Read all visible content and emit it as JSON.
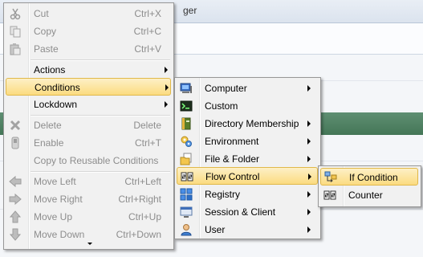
{
  "window": {
    "title_fragment": "ger"
  },
  "context_menu": {
    "items": [
      {
        "label": "Cut",
        "shortcut": "Ctrl+X",
        "icon": "cut-icon",
        "enabled": false
      },
      {
        "label": "Copy",
        "shortcut": "Ctrl+C",
        "icon": "copy-icon",
        "enabled": false
      },
      {
        "label": "Paste",
        "shortcut": "Ctrl+V",
        "icon": "paste-icon",
        "enabled": false
      },
      {
        "label": "Actions",
        "submenu": true,
        "enabled": true
      },
      {
        "label": "Conditions",
        "submenu": true,
        "enabled": true,
        "highlighted": true
      },
      {
        "label": "Lockdown",
        "submenu": true,
        "enabled": true
      },
      {
        "label": "Delete",
        "shortcut": "Delete",
        "icon": "delete-icon",
        "enabled": false
      },
      {
        "label": "Enable",
        "shortcut": "Ctrl+T",
        "icon": "enable-icon",
        "enabled": false
      },
      {
        "label": "Copy to Reusable Conditions",
        "enabled": false
      },
      {
        "label": "Move Left",
        "shortcut": "Ctrl+Left",
        "icon": "arrow-left-icon",
        "enabled": false
      },
      {
        "label": "Move Right",
        "shortcut": "Ctrl+Right",
        "icon": "arrow-right-icon",
        "enabled": false
      },
      {
        "label": "Move Up",
        "shortcut": "Ctrl+Up",
        "icon": "arrow-up-icon",
        "enabled": false
      },
      {
        "label": "Move Down",
        "shortcut": "Ctrl+Down",
        "icon": "arrow-down-icon",
        "enabled": false
      }
    ]
  },
  "conditions_menu": {
    "items": [
      {
        "label": "Computer",
        "submenu": true,
        "icon": "computer-icon"
      },
      {
        "label": "Custom",
        "submenu": false,
        "icon": "custom-script-icon"
      },
      {
        "label": "Directory Membership",
        "submenu": true,
        "icon": "directory-book-icon"
      },
      {
        "label": "Environment",
        "submenu": true,
        "icon": "environment-gear-icon"
      },
      {
        "label": "File & Folder",
        "submenu": true,
        "icon": "file-folder-icon"
      },
      {
        "label": "Flow Control",
        "submenu": true,
        "icon": "flow-control-icon",
        "highlighted": true
      },
      {
        "label": "Registry",
        "submenu": true,
        "icon": "registry-cubes-icon"
      },
      {
        "label": "Session & Client",
        "submenu": true,
        "icon": "session-client-icon"
      },
      {
        "label": "User",
        "submenu": true,
        "icon": "user-icon"
      }
    ]
  },
  "flow_control_menu": {
    "items": [
      {
        "label": "If Condition",
        "icon": "if-condition-icon",
        "highlighted": true
      },
      {
        "label": "Counter",
        "icon": "counter-icon"
      }
    ]
  },
  "colors": {
    "highlight_top": "#fdf0c6",
    "highlight_bottom": "#fbdb80",
    "highlight_border": "#e0b84a",
    "disabled_text": "#8d8d8d"
  }
}
